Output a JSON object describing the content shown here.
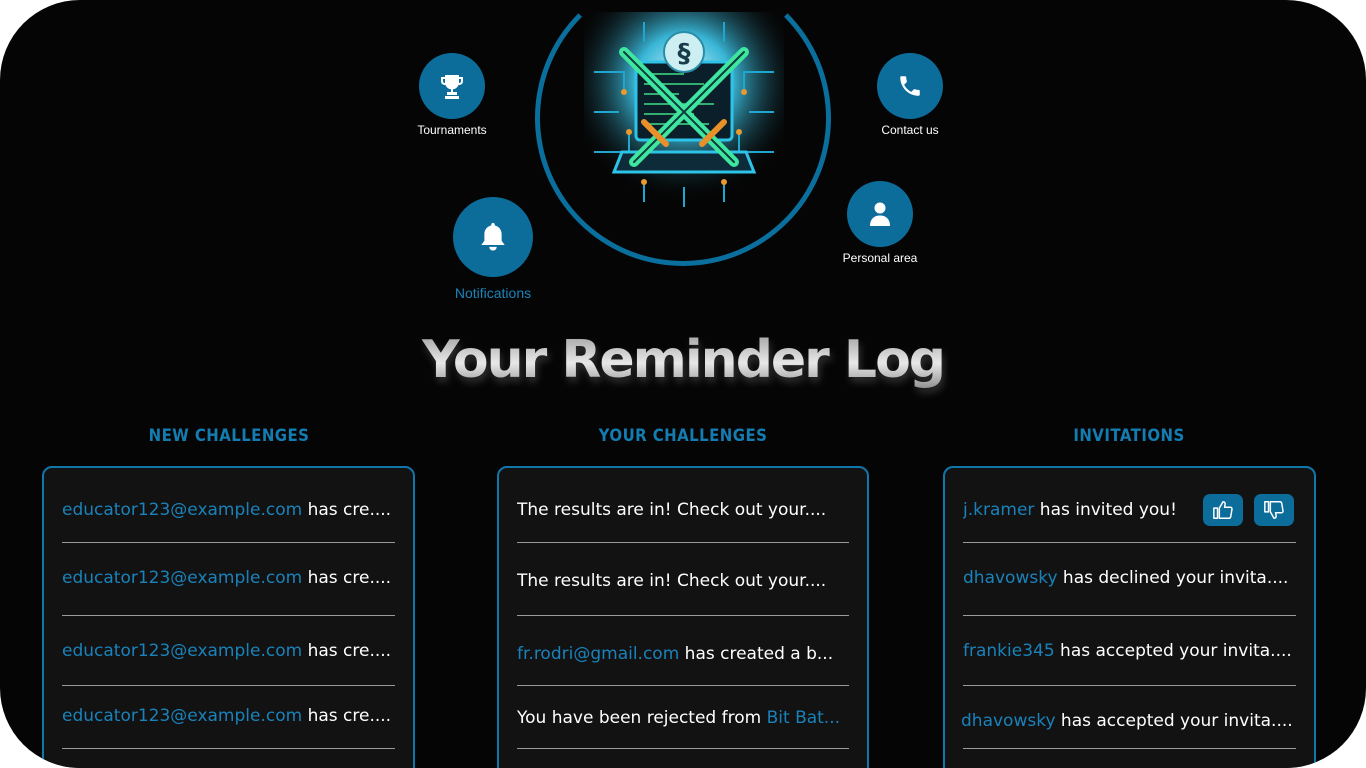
{
  "nav": {
    "tournaments": "Tournaments",
    "contact": "Contact us",
    "notifications": "Notifications",
    "personal": "Personal area"
  },
  "title": "Your Reminder Log",
  "columns": {
    "new_challenges": {
      "title": "NEW CHALLENGES",
      "rows": [
        {
          "user": "educator123@example.com",
          "text": " has cre...."
        },
        {
          "user": "educator123@example.com",
          "text": " has cre...."
        },
        {
          "user": "educator123@example.com",
          "text": " has cre...."
        },
        {
          "user": "educator123@example.com",
          "text": " has cre...."
        }
      ]
    },
    "your_challenges": {
      "title": "YOUR CHALLENGES",
      "rows": [
        {
          "pre": "The results are in! Check out your....",
          "hl": "",
          "post": ""
        },
        {
          "pre": "The results are in! Check out your....",
          "hl": "",
          "post": ""
        },
        {
          "pre": "",
          "hl": "fr.rodri@gmail.com",
          "post": " has created a b..."
        },
        {
          "pre": "You have been rejected from ",
          "hl": "Bit Bat...",
          "post": ""
        }
      ]
    },
    "invitations": {
      "title": "INVITATIONS",
      "rows": [
        {
          "user": "j.kramer",
          "text": " has invited you!"
        },
        {
          "user": "dhavowsky",
          "text": " has declined your invita...."
        },
        {
          "user": "frankie345",
          "text": " has accepted your invita...."
        },
        {
          "user": "dhavowsky",
          "text": " has accepted your invita...."
        }
      ]
    }
  },
  "colors": {
    "accent": "#0c6d9b",
    "link": "#1a82ba",
    "background": "#050505",
    "panel": "#121212"
  },
  "icons": [
    "trophy-icon",
    "phone-icon",
    "bell-icon",
    "user-icon",
    "thumbs-up-icon",
    "thumbs-down-icon"
  ]
}
